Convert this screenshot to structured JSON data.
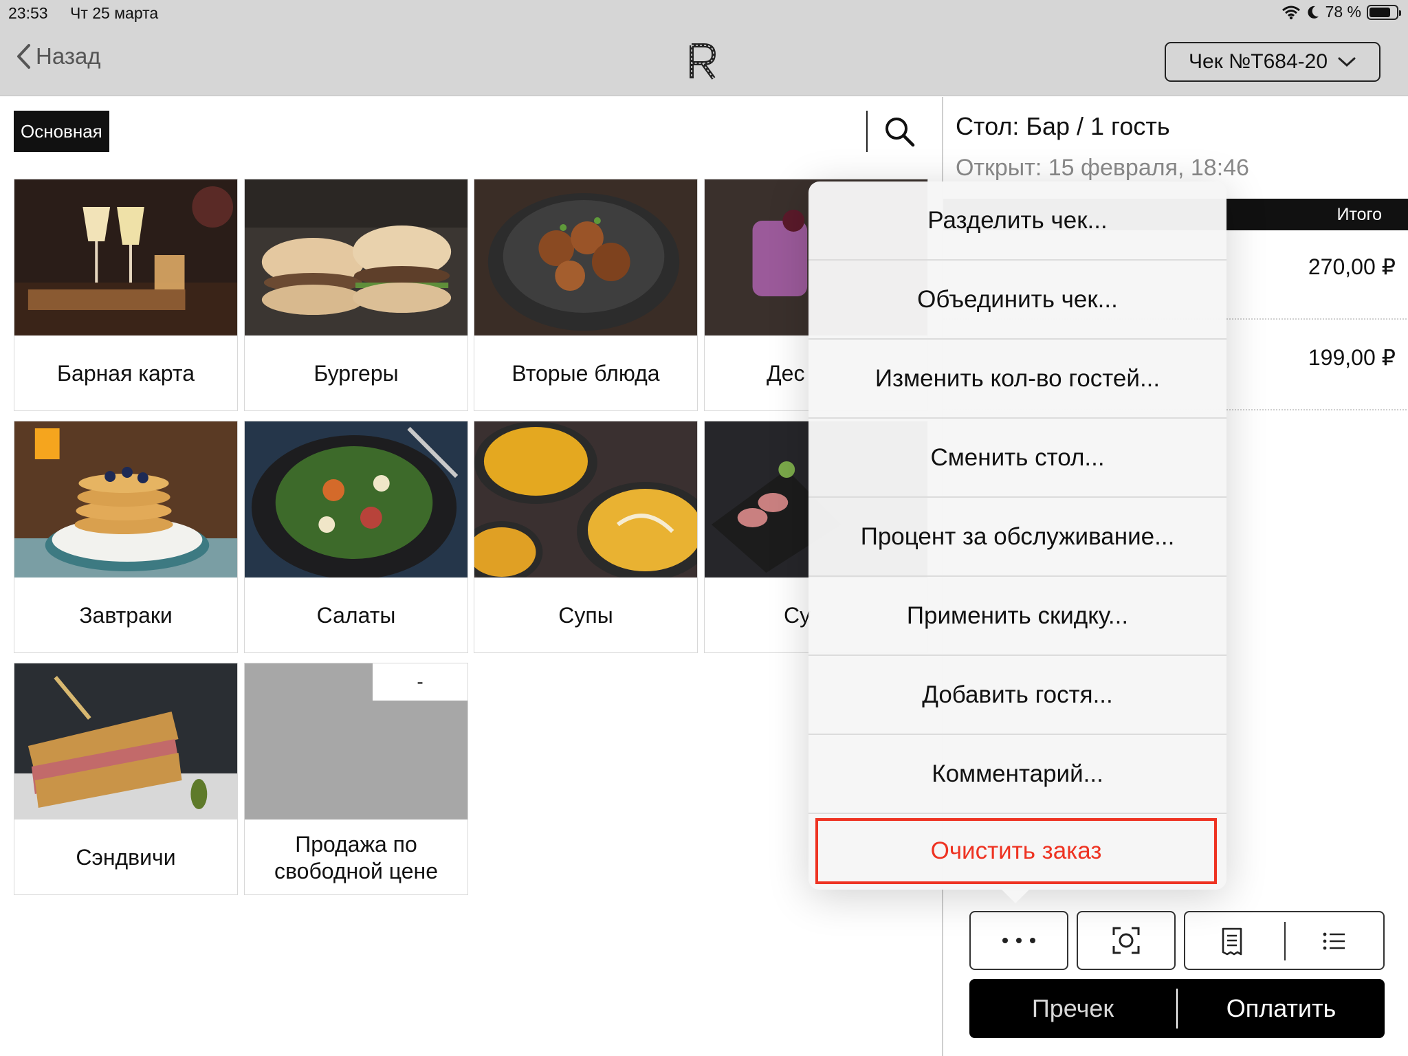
{
  "status_bar": {
    "time": "23:53",
    "date": "Чт 25 марта",
    "battery": "78 %"
  },
  "nav": {
    "back_label": "Назад",
    "receipt_selector": "Чек №Т684-20"
  },
  "catalog": {
    "tab_label": "Основная",
    "tiles": [
      {
        "label": "Барная карта",
        "image": "bar-cocktails"
      },
      {
        "label": "Бургеры",
        "image": "burgers"
      },
      {
        "label": "Вторые блюда",
        "image": "main-dish-pan"
      },
      {
        "label": "Дес",
        "image": "dessert"
      },
      {
        "label": "Завтраки",
        "image": "pancakes"
      },
      {
        "label": "Салаты",
        "image": "salad"
      },
      {
        "label": "Супы",
        "image": "soups"
      },
      {
        "label": "Су",
        "image": "sushi-plate"
      },
      {
        "label": "Сэндвичи",
        "image": "sandwich"
      },
      {
        "label": "Продажа по свободной цене",
        "image": "placeholder",
        "badge": "-"
      }
    ]
  },
  "order": {
    "table": "Стол: Бар / 1 гость",
    "opened": "Открыт: 15 февраля, 18:46",
    "total_column": "Итого",
    "lines": [
      {
        "sum": "270,00 ₽"
      },
      {
        "sum": "199,00 ₽"
      }
    ],
    "actions": {
      "precheck": "Пречек",
      "pay": "Оплатить"
    }
  },
  "menu": {
    "items": [
      "Разделить чек...",
      "Объединить чек...",
      "Изменить кол-во гостей...",
      "Сменить стол...",
      "Процент за обслуживание...",
      "Применить скидку...",
      "Добавить гостя...",
      "Комментарий..."
    ],
    "danger_item": "Очистить заказ",
    "danger_color": "#ee3322"
  },
  "icons": [
    "wifi-icon",
    "moon-icon",
    "battery-icon",
    "chevron-left-icon",
    "chevron-down-icon",
    "search-icon",
    "more-icon",
    "scan-icon",
    "receipt-icon",
    "list-icon"
  ]
}
